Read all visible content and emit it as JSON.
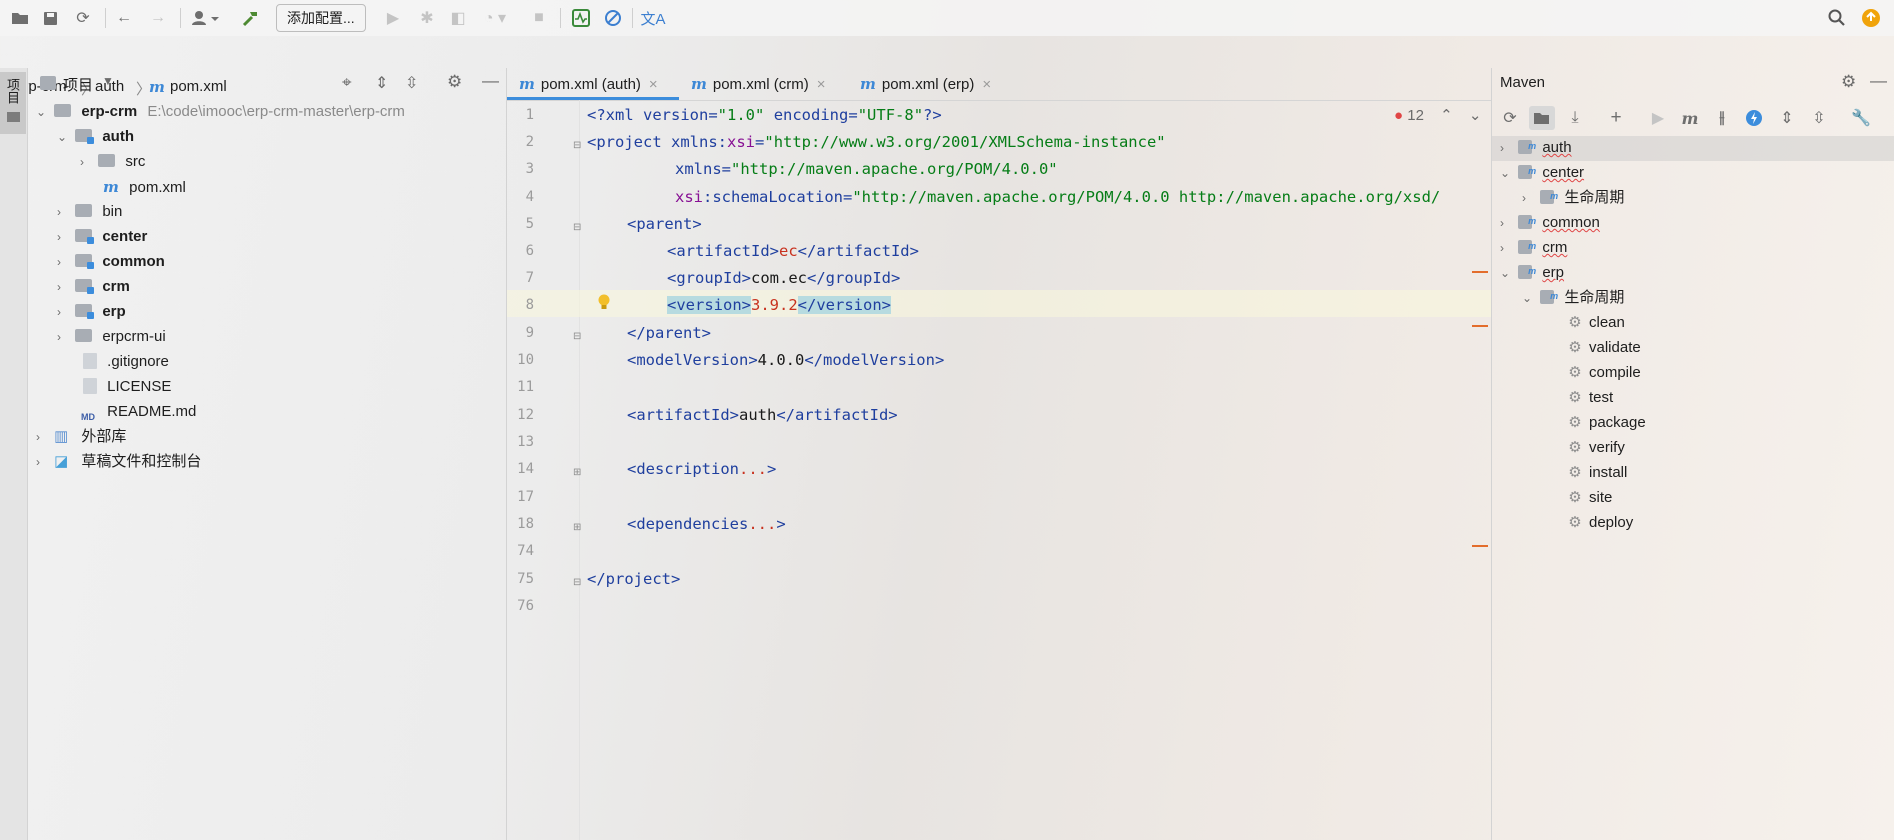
{
  "toolbar": {
    "add_config_label": "添加配置...",
    "icons": [
      "folder-open-icon",
      "save-icon",
      "sync-icon",
      "back-icon",
      "forward-icon",
      "user-icon",
      "build-icon",
      "run-icon",
      "debug-icon",
      "coverage-icon",
      "profile-icon",
      "stop-icon",
      "pulse-icon",
      "no-icon",
      "translate-icon",
      "search-icon",
      "update-icon"
    ]
  },
  "breadcrumb": {
    "items": [
      "erp-crm",
      "auth",
      "pom.xml"
    ]
  },
  "left_strip": {
    "tab_label": "项目"
  },
  "project_panel": {
    "title": "项目",
    "tree": [
      {
        "label": "erp-crm",
        "path": "E:\\code\\imooc\\erp-crm-master\\erp-crm"
      },
      {
        "label": "auth"
      },
      {
        "label": "src"
      },
      {
        "label": "pom.xml"
      },
      {
        "label": "bin"
      },
      {
        "label": "center"
      },
      {
        "label": "common"
      },
      {
        "label": "crm"
      },
      {
        "label": "erp"
      },
      {
        "label": "erpcrm-ui"
      },
      {
        "label": ".gitignore"
      },
      {
        "label": "LICENSE"
      },
      {
        "label": "README.md",
        "badge": "MD"
      },
      {
        "label": "外部库"
      },
      {
        "label": "草稿文件和控制台"
      }
    ]
  },
  "editor": {
    "tabs": [
      {
        "label": "pom.xml (auth)",
        "active": true
      },
      {
        "label": "pom.xml (crm)"
      },
      {
        "label": "pom.xml (erp)"
      }
    ],
    "problem_count": "12",
    "line_numbers": [
      "1",
      "2",
      "3",
      "4",
      "5",
      "6",
      "7",
      "8",
      "9",
      "10",
      "11",
      "12",
      "13",
      "14",
      "17",
      "18",
      "74",
      "75",
      "76"
    ],
    "code": {
      "xml_version": "1.0",
      "encoding": "UTF-8",
      "xsi_uri": "http://www.w3.org/2001/XMLSchema-instance",
      "ns_uri": "http://maven.apache.org/POM/4.0.0",
      "schema_loc": "http://maven.apache.org/POM/4.0.0 http://maven.apache.org/xsd/",
      "parent_artifact": "ec",
      "parent_group": "com.ec",
      "parent_version": "3.9.2",
      "model_version": "4.0.0",
      "artifact_id": "auth"
    }
  },
  "maven_panel": {
    "title": "Maven",
    "modules": [
      {
        "label": "auth",
        "expanded": false
      },
      {
        "label": "center",
        "expanded": true
      },
      {
        "label": "common",
        "expanded": false
      },
      {
        "label": "crm",
        "expanded": false
      },
      {
        "label": "erp",
        "expanded": true
      }
    ],
    "lifecycle_label": "生命周期",
    "lifecycle_center": "生命周期",
    "phases": [
      "clean",
      "validate",
      "compile",
      "test",
      "package",
      "verify",
      "install",
      "site",
      "deploy"
    ]
  }
}
